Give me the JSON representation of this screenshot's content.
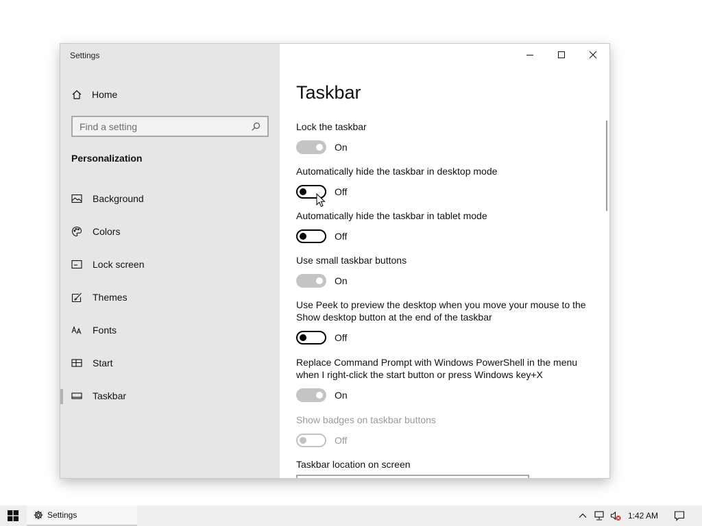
{
  "window": {
    "title": "Settings"
  },
  "sidebar": {
    "home_label": "Home",
    "search_placeholder": "Find a setting",
    "section_title": "Personalization",
    "items": [
      {
        "label": "Background",
        "icon": "image-icon"
      },
      {
        "label": "Colors",
        "icon": "palette-icon"
      },
      {
        "label": "Lock screen",
        "icon": "lock-screen-icon"
      },
      {
        "label": "Themes",
        "icon": "themes-brush-icon"
      },
      {
        "label": "Fonts",
        "icon": "fonts-icon"
      },
      {
        "label": "Start",
        "icon": "start-tiles-icon"
      },
      {
        "label": "Taskbar",
        "icon": "taskbar-icon",
        "selected": true
      }
    ]
  },
  "content": {
    "page_title": "Taskbar",
    "settings": [
      {
        "label": "Lock the taskbar",
        "state": "On"
      },
      {
        "label": "Automatically hide the taskbar in desktop mode",
        "state": "Off"
      },
      {
        "label": "Automatically hide the taskbar in tablet mode",
        "state": "Off"
      },
      {
        "label": "Use small taskbar buttons",
        "state": "On"
      },
      {
        "label": "Use Peek to preview the desktop when you move your mouse to the Show desktop button at the end of the taskbar",
        "state": "Off"
      },
      {
        "label": "Replace Command Prompt with Windows PowerShell in the menu when I right-click the start button or press Windows key+X",
        "state": "On"
      },
      {
        "label": "Show badges on taskbar buttons",
        "state": "Off",
        "disabled": true
      }
    ],
    "location_label": "Taskbar location on screen"
  },
  "taskbar": {
    "app_label": "Settings",
    "time": "1:42 AM"
  },
  "colors": {
    "sidebar_bg": "#e6e6e6",
    "toggle_on": "#c4c4c4",
    "toggle_off_border": "#000000",
    "disabled_text": "#9a9a9a",
    "taskbar_bg": "#eeeeee"
  }
}
